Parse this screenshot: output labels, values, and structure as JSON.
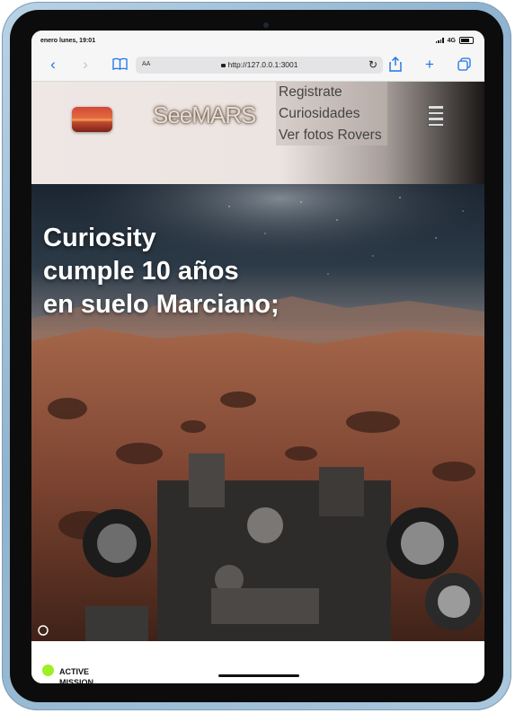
{
  "status_bar": {
    "time": "enero lunes, 19:01",
    "network": "4G"
  },
  "browser": {
    "text_size_label": "AA",
    "url": "http://127.0.0.1:3001",
    "icons": [
      "back-icon",
      "forward-icon",
      "reader-icon",
      "share-icon",
      "plus-icon",
      "tabs-icon",
      "reload-icon",
      "lock-icon"
    ]
  },
  "site": {
    "brand": "SeeMARS",
    "nav": [
      "Registrate",
      "Curiosidades",
      "Ver fotos Rovers"
    ]
  },
  "hero": {
    "title_lines": [
      "Curiosity",
      "cumple 10 años",
      "en suelo Marciano;"
    ]
  },
  "mission": {
    "status": "ACTIVE MISSION",
    "status_color": "#9cf023"
  }
}
